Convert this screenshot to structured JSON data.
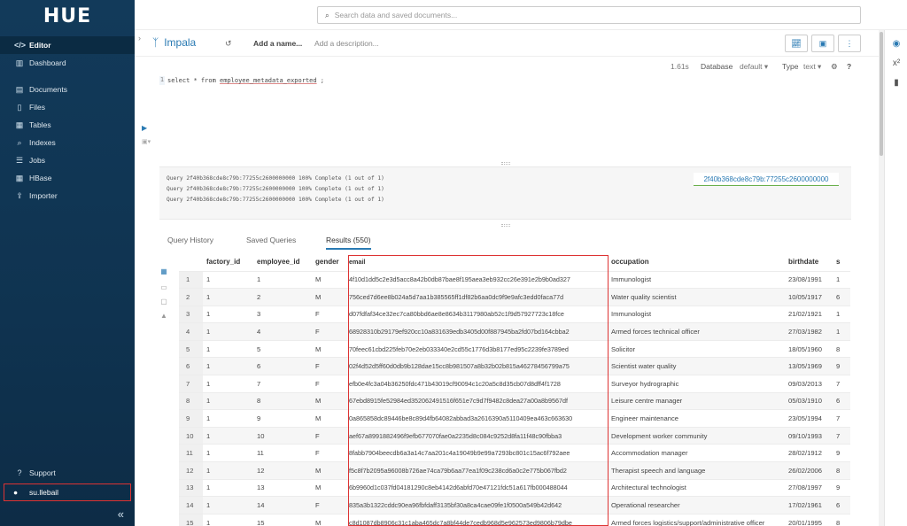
{
  "sidebar": {
    "logo": "HUE",
    "items": [
      {
        "label": "Editor",
        "icon": "code-icon",
        "glyph": "</>",
        "active": true
      },
      {
        "label": "Dashboard",
        "icon": "dashboard-icon",
        "glyph": "▥"
      }
    ],
    "items2": [
      {
        "label": "Documents",
        "icon": "documents-icon",
        "glyph": "▤"
      },
      {
        "label": "Files",
        "icon": "files-icon",
        "glyph": "▯"
      },
      {
        "label": "Tables",
        "icon": "tables-icon",
        "glyph": "▦"
      },
      {
        "label": "Indexes",
        "icon": "indexes-icon",
        "glyph": "⌕"
      },
      {
        "label": "Jobs",
        "icon": "jobs-icon",
        "glyph": "☰"
      },
      {
        "label": "HBase",
        "icon": "hbase-icon",
        "glyph": "▦"
      },
      {
        "label": "Importer",
        "icon": "importer-icon",
        "glyph": "⇪"
      }
    ],
    "support": "Support",
    "user": "su.llebail",
    "collapse_glyph": "«"
  },
  "search": {
    "placeholder": "Search data and saved documents..."
  },
  "editor": {
    "type": "Impala",
    "add_name": "Add a name...",
    "add_description": "Add a description...",
    "elapsed": "1.61s",
    "database_label": "Database",
    "database_value": "default ▾",
    "type_label": "Type",
    "type_value": "text ▾",
    "code_line_num": "1",
    "code_prefix": "select * from ",
    "code_table": "employee_metadata_exported",
    "code_suffix": " ;"
  },
  "log": {
    "lines": [
      "Query 2f40b368cde8c79b:77255c2600000000 100% Complete (1 out of 1)",
      "Query 2f40b368cde8c79b:77255c2600000000 100% Complete (1 out of 1)",
      "Query 2f40b368cde8c79b:77255c2600000000 100% Complete (1 out of 1)"
    ],
    "query_id": "2f40b368cde8c79b:77255c2600000000"
  },
  "tabs": {
    "history": "Query History",
    "saved": "Saved Queries",
    "results": "Results (550)"
  },
  "table": {
    "headers": [
      "",
      "factory_id",
      "employee_id",
      "gender",
      "email",
      "occupation",
      "birthdate",
      "s"
    ],
    "rows": [
      [
        "1",
        "1",
        "1",
        "M",
        "4f10d1dd5c2e3d5acc8a42b0db87bae8f195aea3eb932cc26e391e2b9b0ad327",
        "Immunologist",
        "23/08/1991",
        "1"
      ],
      [
        "2",
        "1",
        "2",
        "M",
        "756ced7d6ee8b024a5d7aa1b385565ff1df82b6aa0dc9f9e9afc3edd0faca77d",
        "Water quality scientist",
        "10/05/1917",
        "6"
      ],
      [
        "3",
        "1",
        "3",
        "F",
        "d07fdfaf34ce32ec7ca80bbd6ae8e8634b3117980ab52c1f9d57927723c18fce",
        "Immunologist",
        "21/02/1921",
        "1"
      ],
      [
        "4",
        "1",
        "4",
        "F",
        "68928310b29179ef920cc10a831639edb3405d00f887945ba2fd07bd164cbba2",
        "Armed forces technical officer",
        "27/03/1982",
        "1"
      ],
      [
        "5",
        "1",
        "5",
        "M",
        "70feec61cbd225feb70e2eb033340e2cd55c1776d3b8177ed95c2239fe3789ed",
        "Solicitor",
        "18/05/1960",
        "8"
      ],
      [
        "6",
        "1",
        "6",
        "F",
        "02f4d52d5ff60d0db9b128dae15cc8b981507a8b32b02b815a46278456799a75",
        "Scientist water quality",
        "13/05/1969",
        "9"
      ],
      [
        "7",
        "1",
        "7",
        "F",
        "efb0e4fc3a04b36250fdc471b43019cf90094c1c20a5c8d35cb07d8dff4f1728",
        "Surveyor hydrographic",
        "09/03/2013",
        "7"
      ],
      [
        "8",
        "1",
        "8",
        "M",
        "67ebd8915fe52984ed352062491516f651e7c9d7f9482c8dea27a00a8b9567df",
        "Leisure centre manager",
        "05/03/1910",
        "6"
      ],
      [
        "9",
        "1",
        "9",
        "M",
        "0a865858dc89446be8c89d4fb64082abbad3a2616390a5110409ea463c663630",
        "Engineer maintenance",
        "23/05/1994",
        "7"
      ],
      [
        "10",
        "1",
        "10",
        "F",
        "aef67a8991882496f9efb677070fae0a2235d8c084c9252d8fa11f48c90fbba3",
        "Development worker community",
        "09/10/1993",
        "7"
      ],
      [
        "11",
        "1",
        "11",
        "F",
        "8fabb7904beecdb6a3a14c7aa201c4a19049b9e99a7293bc801c15ac6f792aee",
        "Accommodation manager",
        "28/02/1912",
        "9"
      ],
      [
        "12",
        "1",
        "12",
        "M",
        "f5c8f7b2095a96008b726ae74ca79b6aa77ea1f09c238cd6a0c2e775b067fbd2",
        "Therapist speech and language",
        "26/02/2006",
        "8"
      ],
      [
        "13",
        "1",
        "13",
        "M",
        "6b9960d1c037fd04181290c8eb4142d6abfd70e47121fdc51a617fb000488044",
        "Architectural technologist",
        "27/08/1997",
        "9"
      ],
      [
        "14",
        "1",
        "14",
        "F",
        "835a3b1322cddc90ea96fbfdaff3135bf30a8ca4cae09fe1f0500a549b42d642",
        "Operational researcher",
        "17/02/1961",
        "6"
      ],
      [
        "15",
        "1",
        "15",
        "M",
        "c8d1087db8906c31c1aba465dc7a8bf44de7cedb968d5e962573ed9806b79dbe",
        "Armed forces logistics/support/administrative officer",
        "20/01/1995",
        "8"
      ]
    ]
  }
}
